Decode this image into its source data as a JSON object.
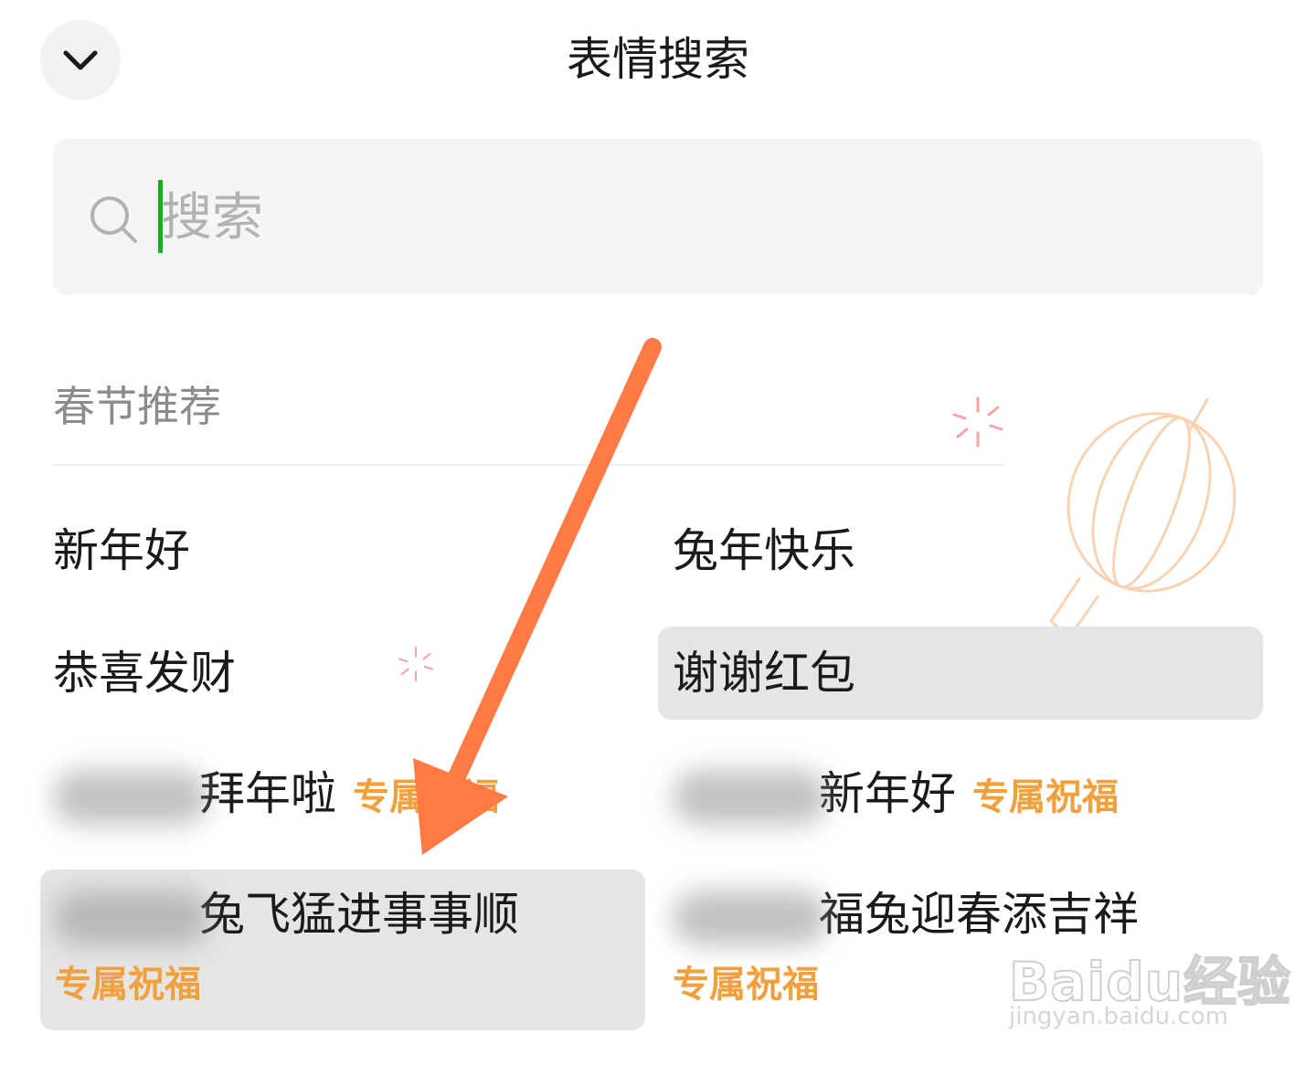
{
  "header": {
    "title": "表情搜索",
    "back_icon": "chevron-down-icon"
  },
  "search": {
    "placeholder": "搜索",
    "value": "",
    "icon": "search-icon"
  },
  "section": {
    "title": "春节推荐"
  },
  "items": [
    {
      "label": "新年好"
    },
    {
      "label": "兔年快乐"
    },
    {
      "label": "恭喜发财"
    },
    {
      "label": "谢谢红包"
    },
    {
      "label": "拜年啦",
      "tag": "专属祝福"
    },
    {
      "label": "新年好",
      "tag": "专属祝福"
    },
    {
      "label": "兔飞猛进事事顺",
      "tag": "专属祝福"
    },
    {
      "label": "福兔迎春添吉祥",
      "tag": "专属祝福"
    }
  ],
  "watermark": {
    "brand": "Baidu经验",
    "url": "jingyan.baidu.com"
  },
  "colors": {
    "accent_tag": "#f0a03c",
    "caret": "#1aad19",
    "arrow": "#ff7a45",
    "highlight": "#e5e5e5"
  }
}
